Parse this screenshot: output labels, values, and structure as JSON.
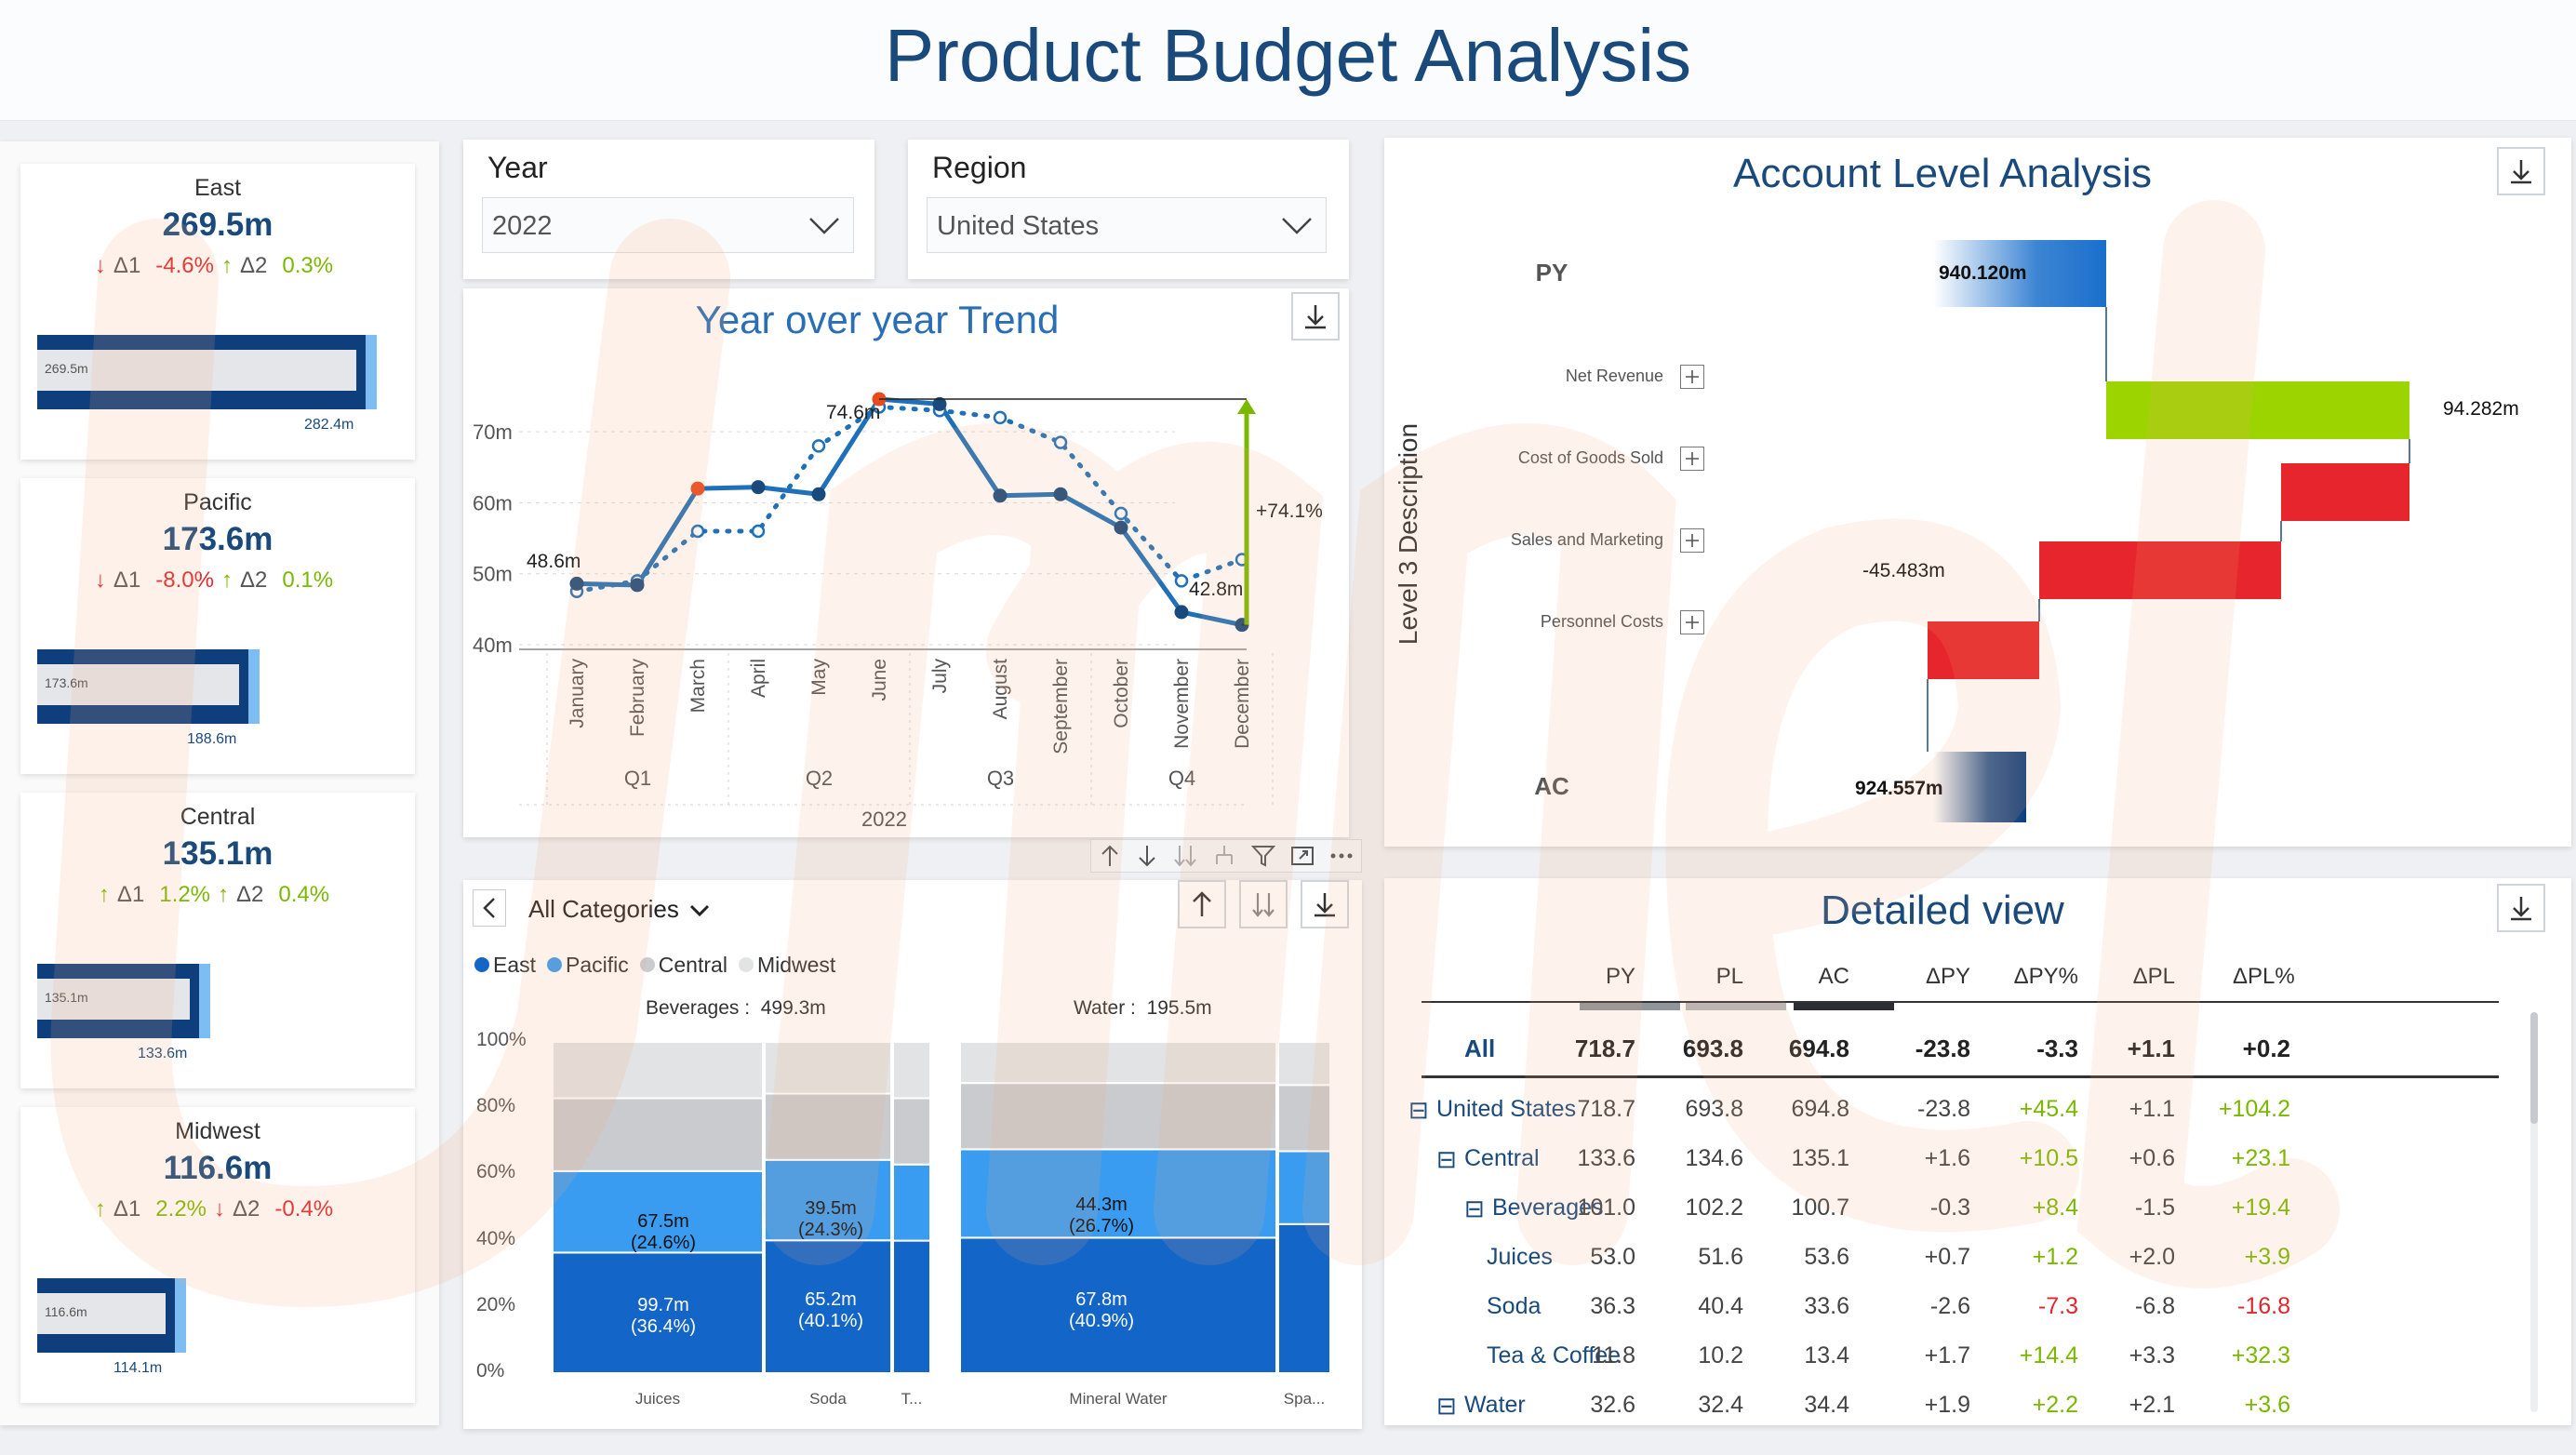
{
  "page": {
    "title": "Product Budget Analysis"
  },
  "kpis": [
    {
      "region": "East",
      "value": "269.5m",
      "d1_label": "Δ1",
      "d1": "-4.6%",
      "d1_dir": "down",
      "d2_label": "Δ2",
      "d2": "0.3%",
      "d2_dir": "up",
      "bar_label": "269.5m",
      "target_label": "282.4m",
      "bar_fraction": 0.955
    },
    {
      "region": "Pacific",
      "value": "173.6m",
      "d1_label": "Δ1",
      "d1": "-8.0%",
      "d1_dir": "down",
      "d2_label": "Δ2",
      "d2": "0.1%",
      "d2_dir": "up",
      "bar_label": "173.6m",
      "target_label": "188.6m",
      "bar_fraction": 0.62
    },
    {
      "region": "Central",
      "value": "135.1m",
      "d1_label": "Δ1",
      "d1": "1.2%",
      "d1_dir": "up",
      "d2_label": "Δ2",
      "d2": "0.4%",
      "d2_dir": "up",
      "bar_label": "135.1m",
      "target_label": "133.6m",
      "bar_fraction": 0.48
    },
    {
      "region": "Midwest",
      "value": "116.6m",
      "d1_label": "Δ1",
      "d1": "2.2%",
      "d1_dir": "up",
      "d2_label": "Δ2",
      "d2": "-0.4%",
      "d2_dir": "down",
      "bar_label": "116.6m",
      "target_label": "114.1m",
      "bar_fraction": 0.41
    }
  ],
  "filters": {
    "year": {
      "label": "Year",
      "value": "2022"
    },
    "region": {
      "label": "Region",
      "value": "United States"
    }
  },
  "trend": {
    "title": "Year over year Trend",
    "y_ticks": [
      "70m",
      "60m",
      "50m",
      "40m"
    ],
    "months": [
      "January",
      "February",
      "March",
      "April",
      "May",
      "June",
      "July",
      "August",
      "September",
      "October",
      "November",
      "December"
    ],
    "quarters": [
      "Q1",
      "Q2",
      "Q3",
      "Q4"
    ],
    "year_label": "2022",
    "start_label": "48.6m",
    "peak_label": "74.6m",
    "end_label": "42.8m",
    "delta_label": "+74.1%"
  },
  "chart_data": [
    {
      "type": "line",
      "title": "Year over year Trend",
      "x": [
        "January",
        "February",
        "March",
        "April",
        "May",
        "June",
        "July",
        "August",
        "September",
        "October",
        "November",
        "December"
      ],
      "ylim": [
        40,
        75
      ],
      "series": [
        {
          "values": [
            48.6,
            48.4,
            62.0,
            62.2,
            61.2,
            74.6,
            73.9,
            61.0,
            61.2,
            56.5,
            44.6,
            42.8
          ]
        },
        {
          "values": [
            47.5,
            49.0,
            56.0,
            56.0,
            68.0,
            73.5,
            73.0,
            72.0,
            68.5,
            58.5,
            49.0,
            52.0
          ]
        }
      ]
    },
    {
      "type": "bar",
      "title": "Account Level Analysis",
      "categories": [
        "PY",
        "Net Revenue",
        "Cost of Goods Sold",
        "Sales and Marketing",
        "Personnel Costs",
        "AC"
      ],
      "values": [
        940.12,
        94.282,
        -30,
        -45.483,
        -34.4,
        924.557
      ]
    },
    {
      "type": "bar",
      "categories": [
        "Juices",
        "Soda",
        "T...",
        "Mineral Water",
        "Spa..."
      ],
      "series": [
        {
          "name": "East",
          "values": [
            36.4,
            40.1,
            40,
            40.9,
            45
          ]
        },
        {
          "name": "Pacific",
          "values": [
            24.6,
            24.3,
            23,
            26.7,
            22
          ]
        },
        {
          "name": "Central",
          "values": [
            22,
            20,
            20,
            20,
            20
          ]
        },
        {
          "name": "Midwest",
          "values": [
            17,
            15.6,
            17,
            12.4,
            13
          ]
        }
      ]
    }
  ],
  "waterfall": {
    "title": "Account Level Analysis",
    "axis_title": "Level 3 Description",
    "rows": [
      {
        "label": "PY",
        "value_label": "940.120m"
      },
      {
        "label": "Net Revenue",
        "value_label": "94.282m"
      },
      {
        "label": "Cost of Goods Sold",
        "value_label": ""
      },
      {
        "label": "Sales and Marketing",
        "value_label": "-45.483m"
      },
      {
        "label": "Personnel Costs",
        "value_label": ""
      },
      {
        "label": "AC",
        "value_label": "924.557m"
      }
    ]
  },
  "mekko": {
    "category_select": "All Categories",
    "legend": [
      "East",
      "Pacific",
      "Central",
      "Midwest"
    ],
    "group1_label": "Beverages :  499.3m",
    "group2_label": "Water :  195.5m",
    "y_ticks": [
      "100%",
      "80%",
      "60%",
      "40%",
      "20%",
      "0%"
    ],
    "columns": [
      "Juices",
      "Soda",
      "T...",
      "Mineral Water",
      "Spa..."
    ],
    "juices_pacific": "67.5m",
    "juices_pacific_pct": "(24.6%)",
    "juices_east": "99.7m",
    "juices_east_pct": "(36.4%)",
    "soda_pacific": "39.5m",
    "soda_pacific_pct": "(24.3%)",
    "soda_east": "65.2m",
    "soda_east_pct": "(40.1%)",
    "mineral_pacific": "44.3m",
    "mineral_pacific_pct": "(26.7%)",
    "mineral_east": "67.8m",
    "mineral_east_pct": "(40.9%)"
  },
  "detail": {
    "title": "Detailed view",
    "headers": [
      "PY",
      "PL",
      "AC",
      "ΔPY",
      "ΔPY%",
      "ΔPL",
      "ΔPL%"
    ],
    "total": {
      "label": "All",
      "cells": [
        "718.7",
        "693.8",
        "694.8",
        "-23.8",
        "-3.3",
        "+1.1",
        "+0.2"
      ]
    },
    "rows": [
      {
        "label": "United States",
        "expander": "⊟",
        "cells": [
          "718.7",
          "693.8",
          "694.8",
          "-23.8",
          "+45.4",
          "+1.1",
          "+104.2"
        ]
      },
      {
        "label": "Central",
        "expander": "⊟",
        "cells": [
          "133.6",
          "134.6",
          "135.1",
          "+1.6",
          "+10.5",
          "+0.6",
          "+23.1"
        ]
      },
      {
        "label": "Beverages",
        "expander": "⊟",
        "cells": [
          "101.0",
          "102.2",
          "100.7",
          "-0.3",
          "+8.4",
          "-1.5",
          "+19.4"
        ]
      },
      {
        "label": "Juices",
        "expander": "",
        "cells": [
          "53.0",
          "51.6",
          "53.6",
          "+0.7",
          "+1.2",
          "+2.0",
          "+3.9"
        ]
      },
      {
        "label": "Soda",
        "expander": "",
        "cells": [
          "36.3",
          "40.4",
          "33.6",
          "-2.6",
          "-7.3",
          "-6.8",
          "-16.8"
        ]
      },
      {
        "label": "Tea & Coffee",
        "expander": "",
        "cells": [
          "11.8",
          "10.2",
          "13.4",
          "+1.7",
          "+14.4",
          "+3.3",
          "+32.3"
        ]
      },
      {
        "label": "Water",
        "expander": "⊟",
        "cells": [
          "32.6",
          "32.4",
          "34.4",
          "+1.9",
          "+2.2",
          "+2.1",
          "+3.6"
        ]
      }
    ]
  },
  "colors": {
    "accent": "#1f5fa8",
    "positive": "#7ab800",
    "negative": "#e0272c",
    "east": "#1366c7",
    "pacific": "#3a9cf0",
    "central": "#c9cbce",
    "midwest": "#e2e3e5",
    "watermark": "#f4a070"
  }
}
